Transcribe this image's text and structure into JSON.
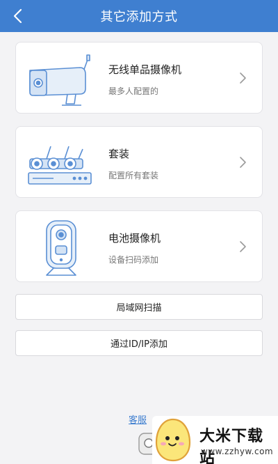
{
  "header": {
    "title": "其它添加方式"
  },
  "cards": [
    {
      "title": "无线单品摄像机",
      "subtitle": "最多人配置的"
    },
    {
      "title": "套装",
      "subtitle": "配置所有套装"
    },
    {
      "title": "电池摄像机",
      "subtitle": "设备扫码添加"
    }
  ],
  "buttons": {
    "lan_scan": "局域网扫描",
    "add_by_id": "通过ID/IP添加"
  },
  "footer": {
    "service_link": "客服"
  },
  "watermark": {
    "title": "大米下载站",
    "url": "www.zzhyw.com"
  },
  "colors": {
    "header": "#3f7fd0",
    "background": "#f3f3f5",
    "illustration": "#5a8fd4"
  }
}
